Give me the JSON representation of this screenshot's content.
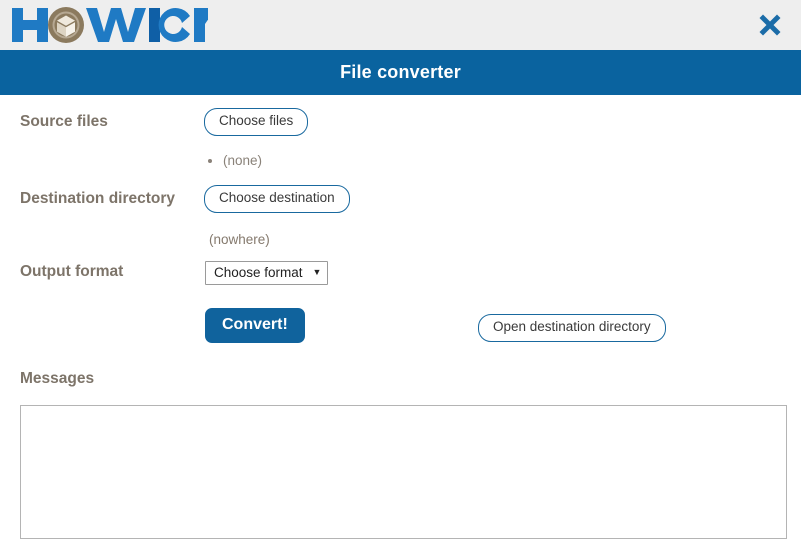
{
  "brand": {
    "name": "HOWICK",
    "logo_icon": "cube-in-circle-icon",
    "text_color": "#1f7ac4",
    "mark_color": "#8b7a5e",
    "close_icon": "close-x-icon",
    "close_color": "#1b6ca8",
    "bar_color": "#eeeeee"
  },
  "titlebar": {
    "title": "File converter",
    "background": "#0a639f",
    "text_color": "#ffffff"
  },
  "form": {
    "source": {
      "label": "Source files",
      "button_label": "Choose files",
      "selected_files": [
        "(none)"
      ]
    },
    "destination": {
      "label": "Destination directory",
      "button_label": "Choose destination",
      "value": "(nowhere)"
    },
    "output_format": {
      "label": "Output format",
      "selected": "Choose format",
      "caret": "▼"
    },
    "actions": {
      "convert_label": "Convert!",
      "open_destination_label": "Open destination directory",
      "convert_color": "#10639d"
    },
    "messages": {
      "label": "Messages",
      "value": "",
      "placeholder": ""
    }
  }
}
